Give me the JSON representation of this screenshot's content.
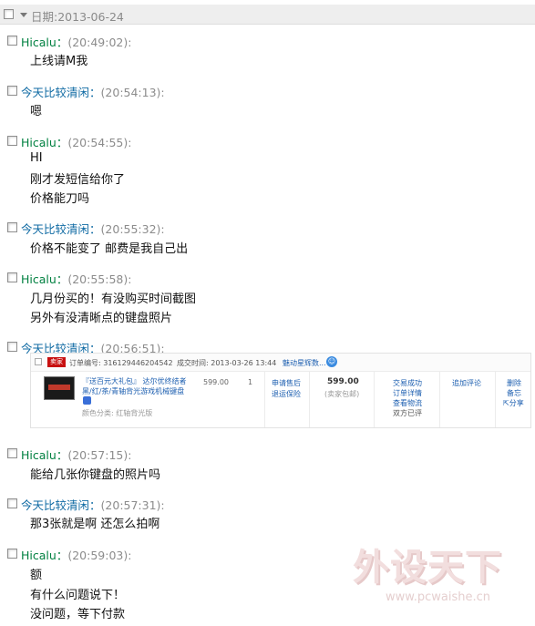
{
  "date_header": {
    "label": "日期:2013-06-24"
  },
  "messages": [
    {
      "name": "Hicalu",
      "time": "(20:49:02):",
      "lines": [
        "上线请M我"
      ]
    },
    {
      "name": "今天比较清闲",
      "time": "(20:54:13):",
      "lines": [
        "嗯"
      ]
    },
    {
      "name": "Hicalu",
      "time": "(20:54:55):",
      "lines": [
        "HI",
        "刚才发短信给你了",
        "价格能刀吗"
      ]
    },
    {
      "name": "今天比较清闲",
      "time": "(20:55:32):",
      "lines": [
        "价格不能变了 邮费是我自己出"
      ]
    },
    {
      "name": "Hicalu",
      "time": "(20:55:58):",
      "lines": [
        "几月份买的！有没购买时间截图",
        "另外有没清晰点的键盘照片"
      ]
    },
    {
      "name": "今天比较清闲",
      "time": "(20:56:51):",
      "lines": []
    },
    {
      "name": "Hicalu",
      "time": "(20:57:15):",
      "lines": [
        "能给几张你键盘的照片吗"
      ]
    },
    {
      "name": "今天比较清闲",
      "time": "(20:57:31):",
      "lines": [
        "那3张就是啊 还怎么拍啊"
      ]
    },
    {
      "name": "Hicalu",
      "time": "(20:59:03):",
      "lines": [
        "额",
        "有什么问题说下！",
        "没问题，等下付款"
      ]
    }
  ],
  "order": {
    "shop_badge": "卖家",
    "order_no_label": "订单编号: 316129446204542",
    "deal_time_label": "成交时间: 2013-03-26 13:44",
    "seller": "魅动星辉数...",
    "product_title_1": "『送百元大礼包』 达尔优终结者",
    "product_title_2": "黑/红/茶/青轴背光游戏机械键盘",
    "product_spec": "颜色分类: 红轴背光版",
    "price": "599.00",
    "quantity": "1",
    "service_1": "申请售后",
    "service_2": "退运保险",
    "total": "599.00",
    "total_note": "(卖家包邮)",
    "status_1": "交易成功",
    "status_2": "订单详情",
    "status_3": "查看物流",
    "status_4": "双方已评",
    "review": "追加评论",
    "action_1": "删除",
    "action_2": "备忘",
    "action_3": "分享"
  },
  "watermark": {
    "brand": "外设天下",
    "url": "www.pcwaishe.cn"
  },
  "colors": {
    "sender_a": "#008040",
    "sender_b": "#0f6aa3",
    "time": "#8c8c8c",
    "date_bar": "#eeeeee"
  }
}
